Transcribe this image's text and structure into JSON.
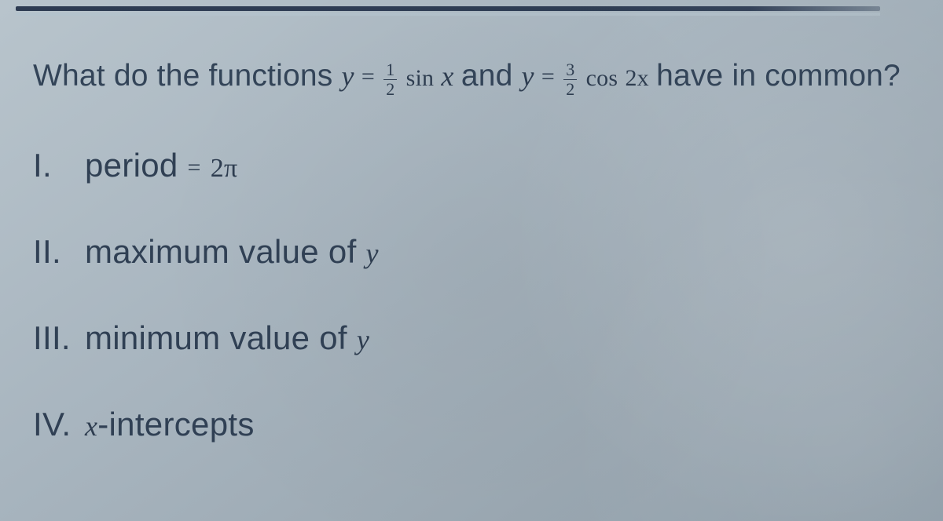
{
  "question": {
    "lead": "What do the functions ",
    "func1": {
      "y": "y",
      "eq": "=",
      "frac_num": "1",
      "frac_den": "2",
      "trig": "sin",
      "arg": "x"
    },
    "and": " and ",
    "func2": {
      "y": "y",
      "eq": "=",
      "frac_num": "3",
      "frac_den": "2",
      "trig": "cos",
      "arg": "2x"
    },
    "tail": " have in common?"
  },
  "options": {
    "i": {
      "label": "I.",
      "text": "period ",
      "eq": "=",
      "value": "2π"
    },
    "ii": {
      "label": "II.",
      "text": "maximum value of ",
      "var": "y"
    },
    "iii": {
      "label": "III.",
      "text": "minimum value of ",
      "var": "y"
    },
    "iv": {
      "label": "IV.",
      "var": "x",
      "text": "-intercepts"
    }
  }
}
